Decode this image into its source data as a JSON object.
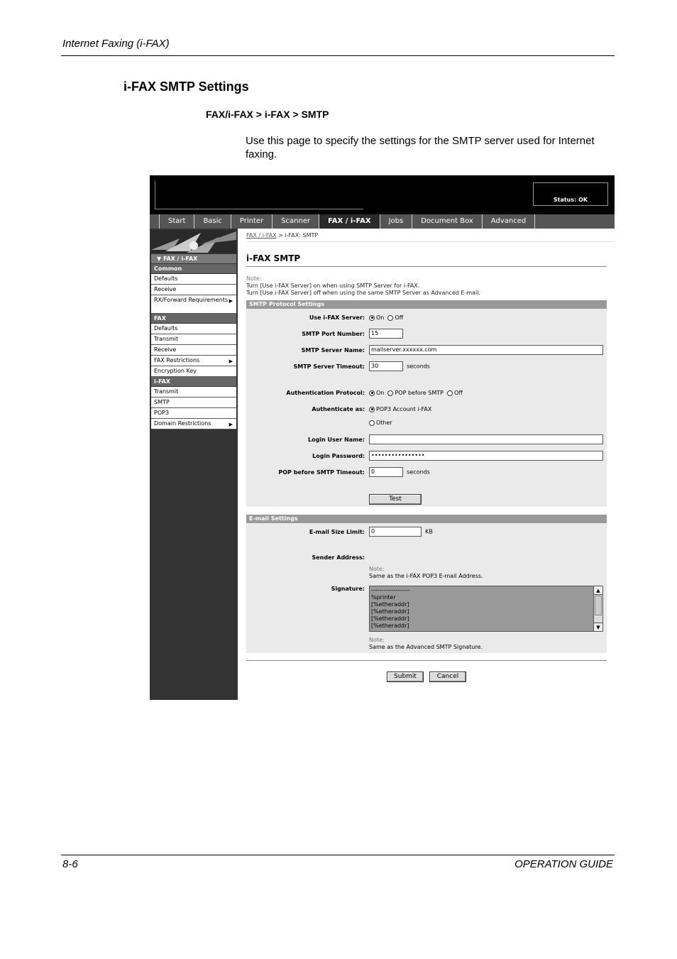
{
  "doc": {
    "header": "Internet Faxing (i-FAX)",
    "section_title": "i-FAX SMTP Settings",
    "path": "FAX/i-FAX > i-FAX > SMTP",
    "intro": "Use this page to specify the settings for the SMTP server used for Internet faxing.",
    "footer_left": "8-6",
    "footer_right": "OPERATION GUIDE"
  },
  "ui": {
    "status": "Status: OK",
    "tabs": [
      "Start",
      "Basic",
      "Printer",
      "Scanner",
      "FAX / i-FAX",
      "Jobs",
      "Document Box",
      "Advanced"
    ],
    "active_tab": "FAX / i-FAX",
    "sidebar": {
      "top": "FAX / i-FAX",
      "common_head": "Common",
      "common": [
        "Defaults",
        "Receive",
        "RX/Forward Requirements"
      ],
      "fax_head": "FAX",
      "fax": [
        "Defaults",
        "Transmit",
        "Receive",
        "FAX Restrictions",
        "Encryption Key"
      ],
      "ifax_head": "i-FAX",
      "ifax": [
        "Transmit",
        "SMTP",
        "POP3",
        "Domain Restrictions"
      ]
    },
    "breadcrumb": {
      "link": "FAX / i-FAX",
      "current": "> i-FAX: SMTP"
    },
    "page_title": "i-FAX SMTP",
    "note_label": "Note:",
    "note_lines": [
      "Turn [Use i-FAX Server] on when using SMTP Server for i-FAX.",
      "Turn [Use i-FAX Server] off when using the same SMTP Server as Advanced E-mail."
    ],
    "smtp_section": "SMTP Protocol Settings",
    "use_server_label": "Use i-FAX Server:",
    "use_server_on": "On",
    "use_server_off": "Off",
    "port_label": "SMTP Port Number:",
    "port_value": "15",
    "server_name_label": "SMTP Server Name:",
    "server_name_value": "mailserver.xxxxxx.com",
    "timeout_label": "SMTP Server Timeout:",
    "timeout_value": "30",
    "seconds": "seconds",
    "auth_label": "Authentication Protocol:",
    "auth_on": "On",
    "auth_pop": "POP before SMTP",
    "auth_off": "Off",
    "auth_as_label": "Authenticate as:",
    "auth_as_pop3": "POP3 Account i-FAX",
    "auth_as_other": "Other",
    "login_user_label": "Login User Name:",
    "login_user_value": "",
    "login_pw_label": "Login Password:",
    "login_pw_value": "••••••••••••••••",
    "pop_timeout_label": "POP before SMTP Timeout:",
    "pop_timeout_value": "0",
    "test_button": "Test",
    "email_section": "E-mail Settings",
    "size_label": "E-mail Size Limit:",
    "size_value": "0",
    "size_unit": "KB",
    "sender_label": "Sender Address:",
    "sender_note": "Same as the i-FAX POP3 E-mail Address.",
    "signature_label": "Signature:",
    "signature_lines": [
      "-------------------",
      "%printer",
      "[%etheraddr]",
      "[%etheraddr]",
      "[%etheraddr]",
      "[%etheraddr]"
    ],
    "signature_note": "Same as the Advanced SMTP Signature.",
    "submit_button": "Submit",
    "cancel_button": "Cancel"
  }
}
